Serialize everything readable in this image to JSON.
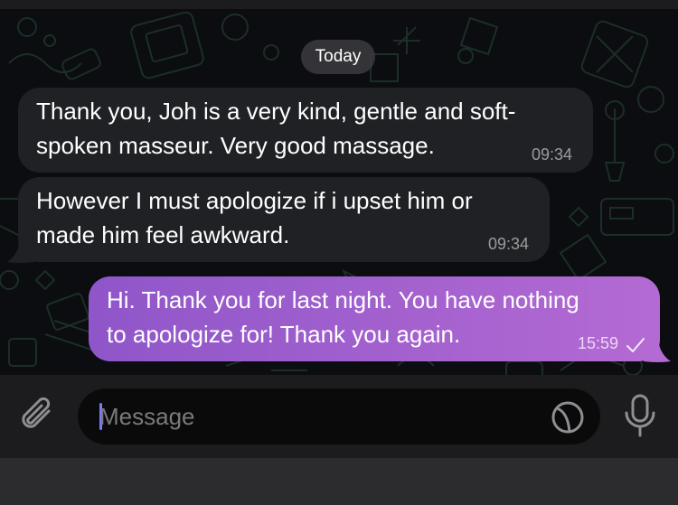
{
  "header": {
    "date_label": "Today"
  },
  "messages": [
    {
      "direction": "incoming",
      "text": "Thank you, Joh is a very kind, gentle and soft-\nspoken masseur. Very good massage.",
      "time": "09:34"
    },
    {
      "direction": "incoming",
      "text": "However I must apologize if i upset him or\nmade him feel awkward.",
      "time": "09:34"
    },
    {
      "direction": "outgoing",
      "text": "Hi. Thank you for last night. You have nothing\nto apologize for! Thank you again.",
      "time": "15:59",
      "status_icon": "checkmark-icon"
    }
  ],
  "composer": {
    "placeholder": "Message",
    "value": "",
    "attach_icon": "paperclip-icon",
    "sticker_icon": "sticker-icon",
    "mic_icon": "microphone-icon"
  },
  "colors": {
    "incoming_bubble": "#1f2124",
    "outgoing_bubble_start": "#8f56c9",
    "outgoing_bubble_end": "#b46ad3",
    "chat_background": "#0b0d10",
    "composer_background": "#1c1c1e",
    "caret": "#7b7bff"
  }
}
